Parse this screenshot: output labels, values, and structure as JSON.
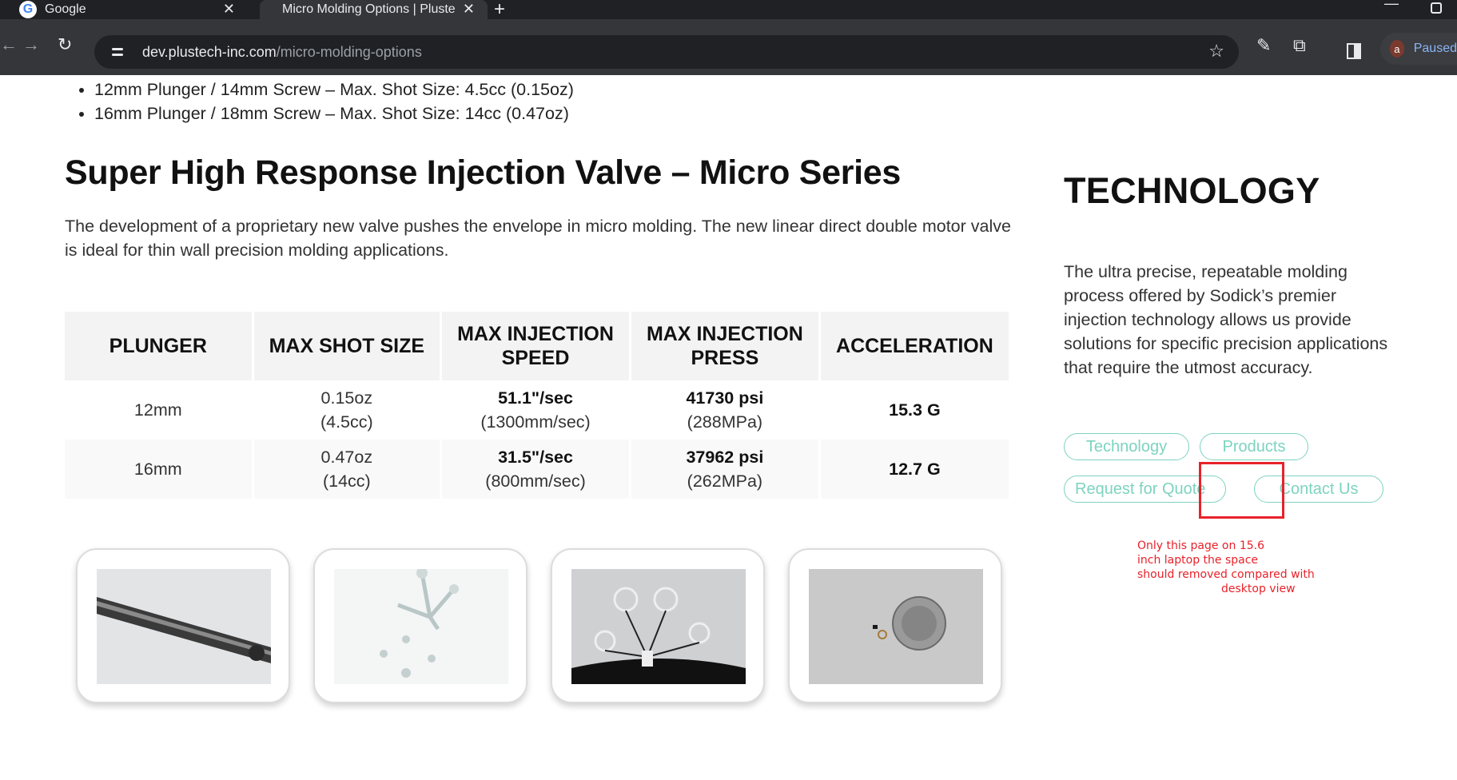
{
  "browser": {
    "tabs": [
      {
        "title": "Google",
        "close": "✕"
      },
      {
        "title": "Micro Molding Options | Pluste",
        "close": "✕"
      }
    ],
    "new_tab": "+",
    "url_domain": "dev.plustech-inc.com",
    "url_path": "/micro-molding-options",
    "profile_initial": "a",
    "profile_status": "Paused"
  },
  "page": {
    "bullets": [
      "12mm Plunger / 14mm Screw – Max. Shot Size: 4.5cc (0.15oz)",
      "16mm Plunger / 18mm Screw – Max. Shot Size: 14cc (0.47oz)"
    ],
    "heading": "Super High Response Injection Valve – Micro Series",
    "intro": "The development of a proprietary new valve pushes the envelope in micro molding. The new linear direct double motor valve is ideal for thin wall precision molding applications.",
    "table": {
      "headers": [
        "PLUNGER",
        "MAX SHOT SIZE",
        "MAX INJECTION SPEED",
        "MAX INJECTION PRESS",
        "ACCELERATION"
      ],
      "rows": [
        {
          "plunger": "12mm",
          "shot_1": "0.15oz",
          "shot_2": "(4.5cc)",
          "speed_1": "51.1\"/sec",
          "speed_2": "(1300mm/sec)",
          "press_1": "41730 psi",
          "press_2": "(288MPa)",
          "accel": "15.3 G"
        },
        {
          "plunger": "16mm",
          "shot_1": "0.47oz",
          "shot_2": "(14cc)",
          "speed_1": "31.5\"/sec",
          "speed_2": "(800mm/sec)",
          "press_1": "37962 psi",
          "press_2": "(262MPa)",
          "accel": "12.7 G"
        }
      ]
    }
  },
  "sidebar": {
    "heading": "TECHNOLOGY",
    "text": "The ultra precise, repeatable molding process offered by Sodick’s premier injection technology allows us provide solutions for specific precision applications that require the utmost accuracy.",
    "links": [
      "Technology",
      "Products",
      "Request for Quote",
      "Contact Us"
    ]
  },
  "annotation": {
    "lines": [
      "Only this page on 15.6",
      "inch laptop the space",
      "should removed compared with",
      "desktop view"
    ],
    "color": "#e8222a"
  },
  "colors": {
    "accent": "#7dd3c0",
    "chrome": "#202124",
    "link": "#8ab4f8"
  }
}
